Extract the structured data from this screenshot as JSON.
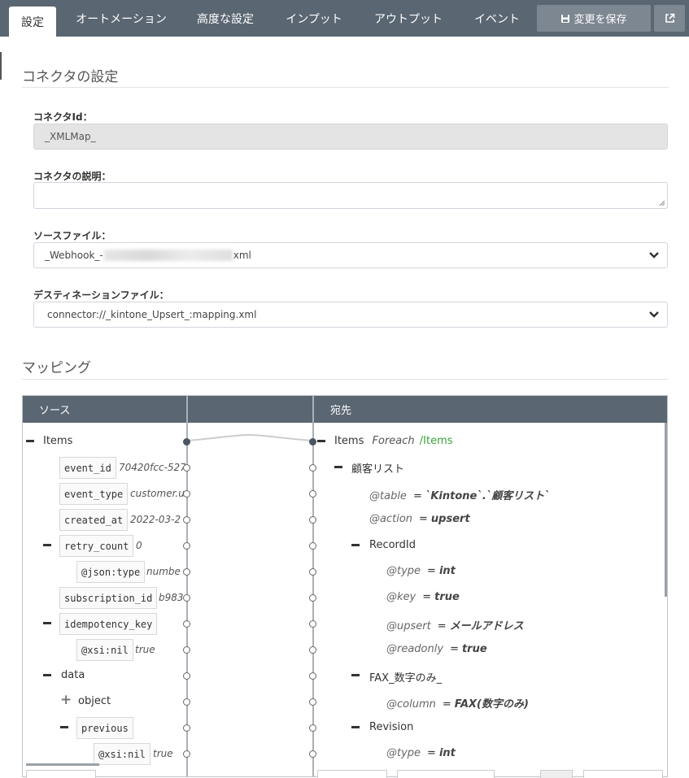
{
  "tabs": [
    {
      "label": "設定",
      "active": true
    },
    {
      "label": "オートメーション",
      "active": false
    },
    {
      "label": "高度な設定",
      "active": false
    },
    {
      "label": "インプット",
      "active": false
    },
    {
      "label": "アウトプット",
      "active": false
    },
    {
      "label": "イベント",
      "active": false
    }
  ],
  "toolbar": {
    "save_label": "変更を保存",
    "save_icon": "floppy-disk-icon",
    "external_icon": "external-link-icon"
  },
  "connector_settings": {
    "title": "コネクタの設定",
    "connector_id_label": "コネクタId：",
    "connector_id_value": "_XMLMap_",
    "description_label": "コネクタの説明：",
    "description_value": "",
    "source_label": "ソースファイル：",
    "source_prefix": "_Webhook_-",
    "source_suffix": "xml",
    "destination_label": "デスティネーションファイル：",
    "destination_value": "connector://_kintone_Upsert_:mapping.xml"
  },
  "mapping": {
    "title": "マッピング",
    "source_header": "ソース",
    "dest_header": "宛先",
    "source_rows": [
      {
        "label": "Items",
        "type": "text"
      },
      {
        "label": "event_id",
        "value": "70420fcc-527"
      },
      {
        "label": "event_type",
        "value": "customer.u"
      },
      {
        "label": "created_at",
        "value": "2022-03-2"
      },
      {
        "label": "retry_count",
        "value": "0"
      },
      {
        "label": "@json:type",
        "value": "numbe"
      },
      {
        "label": "subscription_id",
        "value": "b983"
      },
      {
        "label": "idempotency_key",
        "value": ""
      },
      {
        "label": "@xsi:nil",
        "value": "true"
      },
      {
        "label": "data",
        "type": "text"
      },
      {
        "label": "object",
        "type": "text"
      },
      {
        "label": "previous",
        "value": ""
      },
      {
        "label": "@xsi:nil",
        "value": "true"
      }
    ],
    "dest_rows": [
      {
        "label": "Items",
        "foreach": "Foreach",
        "path": "/Items"
      },
      {
        "label": "顧客リスト"
      },
      {
        "attr": "@table",
        "value": "`Kintone`.`顧客リスト`"
      },
      {
        "attr": "@action",
        "value": "upsert"
      },
      {
        "label": "RecordId"
      },
      {
        "attr": "@type",
        "value": "int"
      },
      {
        "attr": "@key",
        "value": "true"
      },
      {
        "attr": "@upsert",
        "value": "メールアドレス"
      },
      {
        "attr": "@readonly",
        "value": "true"
      },
      {
        "label": "FAX_数字のみ_"
      },
      {
        "attr": "@column",
        "value": "FAX(数字のみ)"
      },
      {
        "label": "Revision"
      },
      {
        "attr": "@type",
        "value": "int"
      }
    ]
  }
}
